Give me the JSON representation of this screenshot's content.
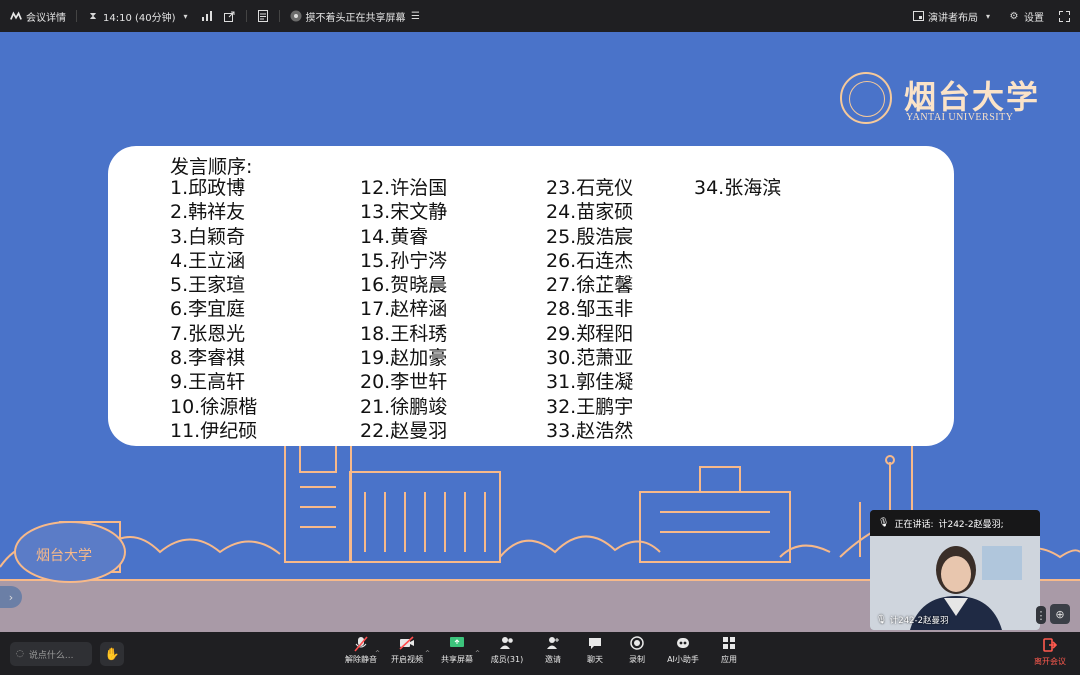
{
  "topbar": {
    "meeting_info": "会议详情",
    "time": "14:10 (40分钟)",
    "share_notice": "摸不着头正在共享屏幕",
    "layout_label": "演讲者布局",
    "settings_label": "设置"
  },
  "slide": {
    "logo_cn": "烟台大学",
    "logo_en": "YANTAI UNIVERSITY",
    "sign_text": "烟台大学",
    "order_title": "发言顺序:",
    "columns": [
      [
        "1.邱政博",
        "2.韩祥友",
        "3.白颖奇",
        "4.王立涵",
        "5.王家瑄",
        "6.李宜庭",
        "7.张恩光",
        "8.李睿祺",
        "9.王高轩",
        "10.徐源楷",
        "11.伊纪硕"
      ],
      [
        "12.许治国",
        "13.宋文静",
        "14.黄睿",
        "15.孙宁涔",
        "16.贺晓晨",
        "17.赵梓涵",
        "18.王科琇",
        "19.赵加豪",
        "20.李世轩",
        "21.徐鹏竣",
        "22.赵曼羽"
      ],
      [
        "23.石竞仪",
        "24.苗家硕",
        "25.殷浩宸",
        "26.石连杰",
        "27.徐芷馨",
        "28.邹玉非",
        "29.郑程阳",
        "30.范萧亚",
        "31.郭佳凝",
        "32.王鹏宇",
        "33.赵浩然"
      ],
      [
        "34.张海滨"
      ]
    ]
  },
  "speaker": {
    "speaking_label": "正在讲话:",
    "speaking_name": "计242-2赵曼羽;",
    "tile_name": "计242-2赵曼羽"
  },
  "bottombar": {
    "chat_placeholder": "说点什么...",
    "tools": {
      "unmute": "解除静音",
      "video": "开启视频",
      "share": "共享屏幕",
      "members": "成员(31)",
      "invite": "邀请",
      "chat": "聊天",
      "record": "录制",
      "ai": "AI小助手",
      "apps": "应用"
    },
    "leave": "离开会议"
  },
  "colors": {
    "slide_bg": "#4a73c9",
    "skyline": "#f7b98a",
    "leave": "#ff5a4e"
  },
  "icons": [
    "meeting-logo-icon",
    "hourglass-icon",
    "signal-icon",
    "popout-icon",
    "doc-icon",
    "share-screen-icon",
    "layout-icon",
    "settings-icon",
    "fullscreen-icon",
    "mic-off-icon",
    "camera-off-icon",
    "share-icon",
    "members-icon",
    "invite-icon",
    "chat-icon",
    "record-icon",
    "ai-icon",
    "apps-icon",
    "leave-icon",
    "hand-icon"
  ]
}
